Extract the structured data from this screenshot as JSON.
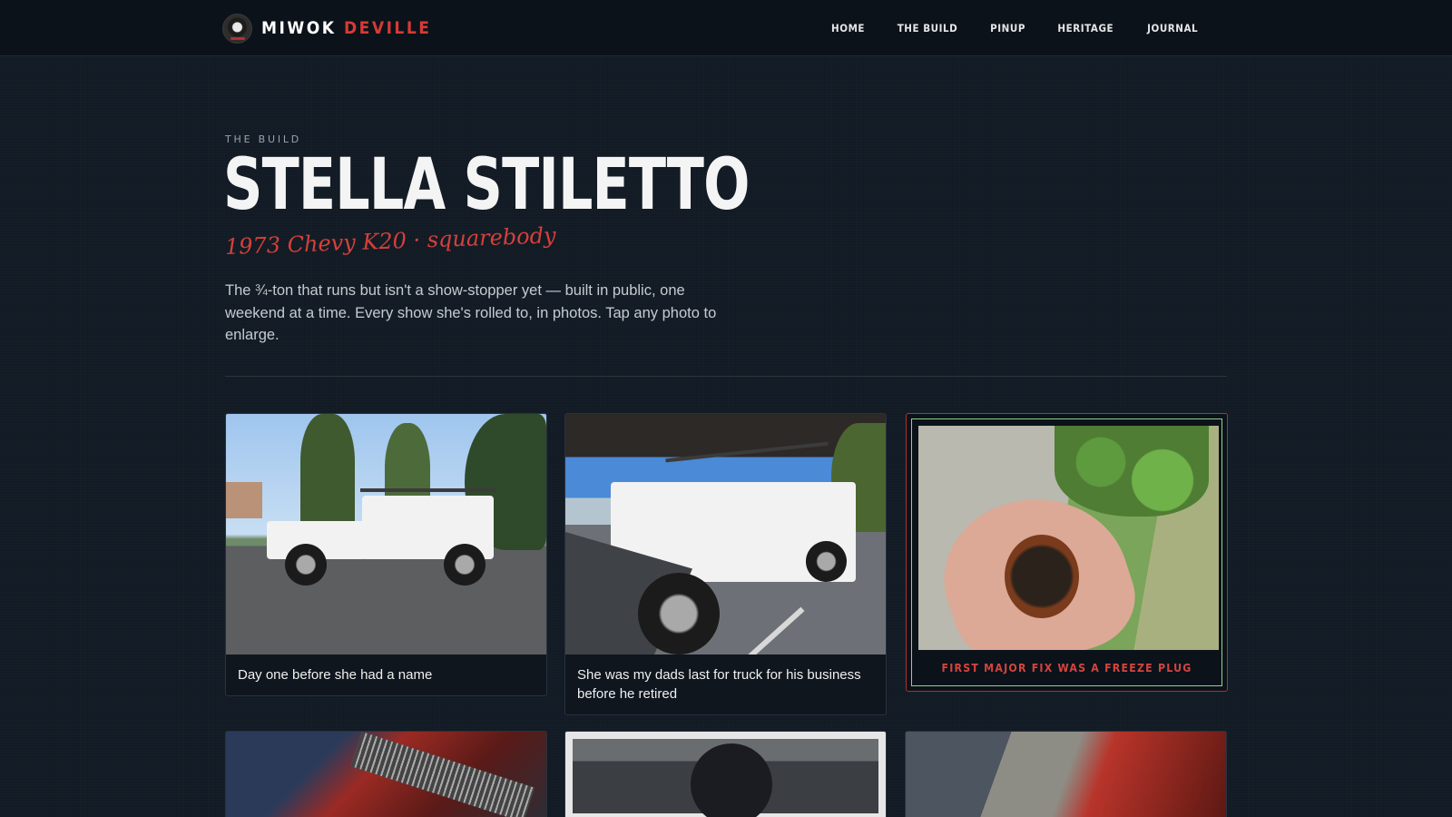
{
  "header": {
    "brand_first": "MIWOK",
    "brand_second": "DEVILLE",
    "nav": [
      "HOME",
      "THE BUILD",
      "PINUP",
      "HERITAGE",
      "JOURNAL"
    ]
  },
  "hero": {
    "eyebrow": "THE BUILD",
    "title": "STELLA STILETTO",
    "subtitle": "1973 Chevy K20 · squarebody",
    "intro": "The ¾-ton that runs but isn't a show-stopper yet — built in public, one weekend at a time. Every show she's rolled to, in photos. Tap any photo to enlarge."
  },
  "gallery": {
    "cards": [
      {
        "caption": "Day one before she had a name"
      },
      {
        "caption": "She was my dads last for truck for his business before he retired"
      },
      {
        "caption": "FIRST MAJOR FIX WAS A FREEZE PLUG"
      }
    ]
  },
  "colors": {
    "accent": "#d73a35",
    "background": "#121b25",
    "header": "#0b1219"
  }
}
